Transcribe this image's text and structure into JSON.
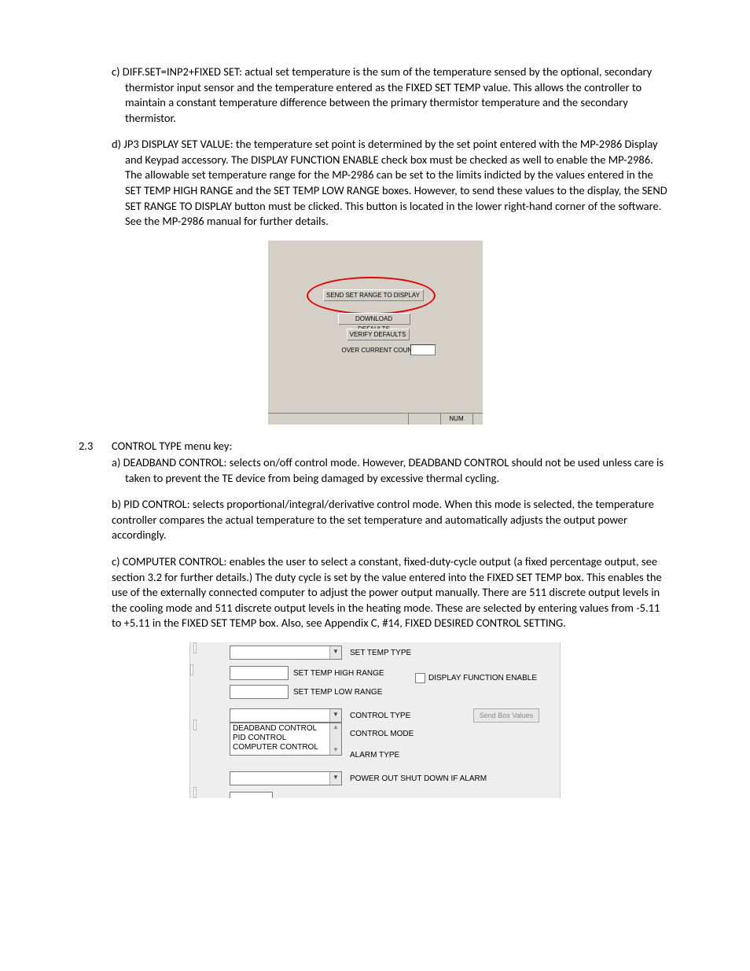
{
  "para_c": "c) DIFF.SET=INP2+FIXED SET:  actual set temperature is the sum of the temperature sensed by the optional, secondary thermistor input sensor and the temperature entered as the FIXED SET TEMP value.  This allows the controller to maintain a constant temperature difference between the primary thermistor temperature and the secondary thermistor.",
  "para_d": "d) JP3 DISPLAY SET VALUE: the temperature set point is determined by the set point entered with the MP-2986 Display and Keypad accessory. The DISPLAY FUNCTION ENABLE check box must be checked as well to enable the MP-2986. The allowable set temperature range for the MP-2986 can be set to the limits indicted by the values entered in the SET TEMP HIGH RANGE and the SET TEMP LOW RANGE boxes. However, to send these values to the display, the SEND SET RANGE TO DISPLAY button must be clicked. This button is located in the lower right-hand corner of the software. See the MP-2986 manual for further details.",
  "fig1": {
    "btn_send": "SEND SET RANGE TO DISPLAY",
    "btn_download": "DOWNLOAD DEFAULTS",
    "btn_verify": "VERIFY DEFAULTS",
    "lbl_over": "OVER CURRENT COUNT",
    "status_num": "NUM"
  },
  "sec": {
    "num": "2.3",
    "title": "CONTROL TYPE menu key:",
    "a": "a) DEADBAND CONTROL:  selects on/off control mode. However, DEADBAND CONTROL should not be used unless care is taken to prevent the TE device from being damaged by excessive thermal cycling.",
    "b": "b) PID CONTROL: selects proportional/integral/derivative control mode. When this mode is selected, the temperature controller compares the actual temperature to the set temperature and automatically adjusts the output power accordingly.",
    "c": "c) COMPUTER CONTROL:  enables the user to select a constant, fixed-duty-cycle output (a fixed percentage output, see section 3.2 for further details.) The duty cycle is set by the value entered into the FIXED SET TEMP box.  This enables the use of the externally connected computer to adjust the power output manually. There are 511 discrete output levels in the cooling mode and 511 discrete output levels in the heating mode.  These are selected by entering values from -5.11 to +5.11 in the FIXED SET TEMP box.  Also, see Appendix C, #14, FIXED DESIRED CONTROL SETTING."
  },
  "fig2": {
    "set_temp_type": "SET TEMP TYPE",
    "set_temp_high": "SET TEMP HIGH RANGE",
    "set_temp_low": "SET TEMP LOW RANGE",
    "display_enable": "DISPLAY FUNCTION ENABLE",
    "control_type": "CONTROL TYPE",
    "control_mode": "CONTROL MODE",
    "alarm_type": "ALARM TYPE",
    "power_out": "POWER OUT SHUT DOWN IF ALARM",
    "send_box": "Send Box Values",
    "list": {
      "i0": "DEADBAND CONTROL",
      "i1": "PID CONTROL",
      "i2": "COMPUTER CONTROL"
    }
  }
}
